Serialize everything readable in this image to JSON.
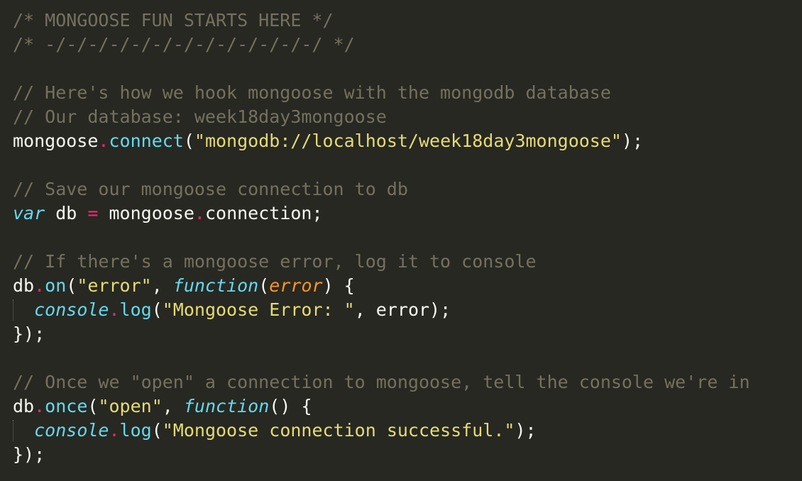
{
  "lines": [
    [
      {
        "t": "/* MONGOOSE FUN STARTS HERE */",
        "c": "cmt"
      }
    ],
    [
      {
        "t": "/* -/-/-/-/-/-/-/-/-/-/-/-/-/ */",
        "c": "cmt"
      }
    ],
    [],
    [
      {
        "t": "// Here's how we hook mongoose with the mongodb database",
        "c": "cmt"
      }
    ],
    [
      {
        "t": "// Our database: week18day3mongoose",
        "c": "cmt"
      }
    ],
    [
      {
        "t": "mongoose",
        "c": "plain"
      },
      {
        "t": ".",
        "c": "dot"
      },
      {
        "t": "connect",
        "c": "fn"
      },
      {
        "t": "(",
        "c": "plain"
      },
      {
        "t": "\"mongodb://localhost/week18day3mongoose\"",
        "c": "str"
      },
      {
        "t": ");",
        "c": "plain"
      }
    ],
    [],
    [
      {
        "t": "// Save our mongoose connection to db",
        "c": "cmt"
      }
    ],
    [
      {
        "t": "var",
        "c": "kw"
      },
      {
        "t": " db ",
        "c": "plain"
      },
      {
        "t": "=",
        "c": "op"
      },
      {
        "t": " mongoose",
        "c": "plain"
      },
      {
        "t": ".",
        "c": "dot"
      },
      {
        "t": "connection;",
        "c": "plain"
      }
    ],
    [],
    [
      {
        "t": "// If there's a mongoose error, log it to console",
        "c": "cmt"
      }
    ],
    [
      {
        "t": "db",
        "c": "plain"
      },
      {
        "t": ".",
        "c": "dot"
      },
      {
        "t": "on",
        "c": "fn"
      },
      {
        "t": "(",
        "c": "plain"
      },
      {
        "t": "\"error\"",
        "c": "str"
      },
      {
        "t": ", ",
        "c": "plain"
      },
      {
        "t": "function",
        "c": "kw"
      },
      {
        "t": "(",
        "c": "plain"
      },
      {
        "t": "error",
        "c": "param"
      },
      {
        "t": ") {",
        "c": "plain"
      }
    ],
    [
      {
        "t": "  ",
        "c": "plain"
      },
      {
        "t": "console",
        "c": "kw"
      },
      {
        "t": ".",
        "c": "dot"
      },
      {
        "t": "log",
        "c": "fn"
      },
      {
        "t": "(",
        "c": "plain"
      },
      {
        "t": "\"Mongoose Error: \"",
        "c": "str"
      },
      {
        "t": ", error);",
        "c": "plain"
      }
    ],
    [
      {
        "t": "});",
        "c": "plain"
      }
    ],
    [],
    [
      {
        "t": "// Once we \"open\" a connection to mongoose, tell the console we're in",
        "c": "cmt"
      }
    ],
    [
      {
        "t": "db",
        "c": "plain"
      },
      {
        "t": ".",
        "c": "dot"
      },
      {
        "t": "once",
        "c": "fn"
      },
      {
        "t": "(",
        "c": "plain"
      },
      {
        "t": "\"open\"",
        "c": "str"
      },
      {
        "t": ", ",
        "c": "plain"
      },
      {
        "t": "function",
        "c": "kw"
      },
      {
        "t": "() {",
        "c": "plain"
      }
    ],
    [
      {
        "t": "  ",
        "c": "plain"
      },
      {
        "t": "console",
        "c": "kw"
      },
      {
        "t": ".",
        "c": "dot"
      },
      {
        "t": "log",
        "c": "fn"
      },
      {
        "t": "(",
        "c": "plain"
      },
      {
        "t": "\"Mongoose connection successful.\"",
        "c": "str"
      },
      {
        "t": ");",
        "c": "plain"
      }
    ],
    [
      {
        "t": "});",
        "c": "plain"
      }
    ]
  ],
  "indent_guide_lines": [
    12,
    17
  ],
  "colors": {
    "background": "#272822",
    "comment": "#75715e",
    "string": "#e6db74",
    "keyword": "#66d9ef",
    "operator": "#f92672",
    "parameter": "#fd971f",
    "text": "#f8f8f2"
  }
}
